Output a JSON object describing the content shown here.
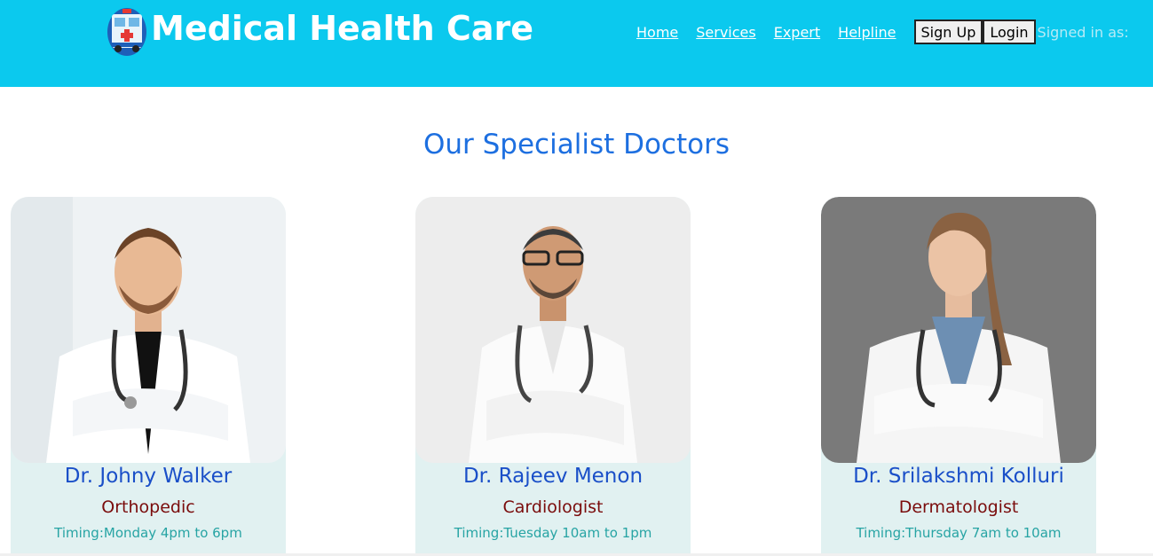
{
  "header": {
    "brand": "Medical Health Care",
    "nav": [
      "Home",
      "Services",
      "Expert",
      "Helpline"
    ],
    "signup_label": "Sign Up",
    "login_label": "Login",
    "signed_in_label": "Signed in as:"
  },
  "main": {
    "heading": "Our Specialist Doctors",
    "doctors": [
      {
        "name": "Dr. Johny Walker",
        "specialty": "Orthopedic",
        "timing": "Timing:Monday 4pm to 6pm"
      },
      {
        "name": "Dr. Rajeev Menon",
        "specialty": "Cardiologist",
        "timing": "Timing:Tuesday 10am to 1pm"
      },
      {
        "name": "Dr. Srilakshmi Kolluri",
        "specialty": "Dermatologist",
        "timing": "Timing:Thursday 7am to 10am"
      }
    ]
  },
  "colors": {
    "header_bg": "#0bc9ee",
    "heading": "#1d6fe0",
    "doctor_name": "#1a4fc8",
    "specialty": "#7a0c0c",
    "timing": "#27a4a4",
    "card_bg": "#e1f1f1"
  },
  "icons": [
    "ambulance-logo-icon"
  ]
}
